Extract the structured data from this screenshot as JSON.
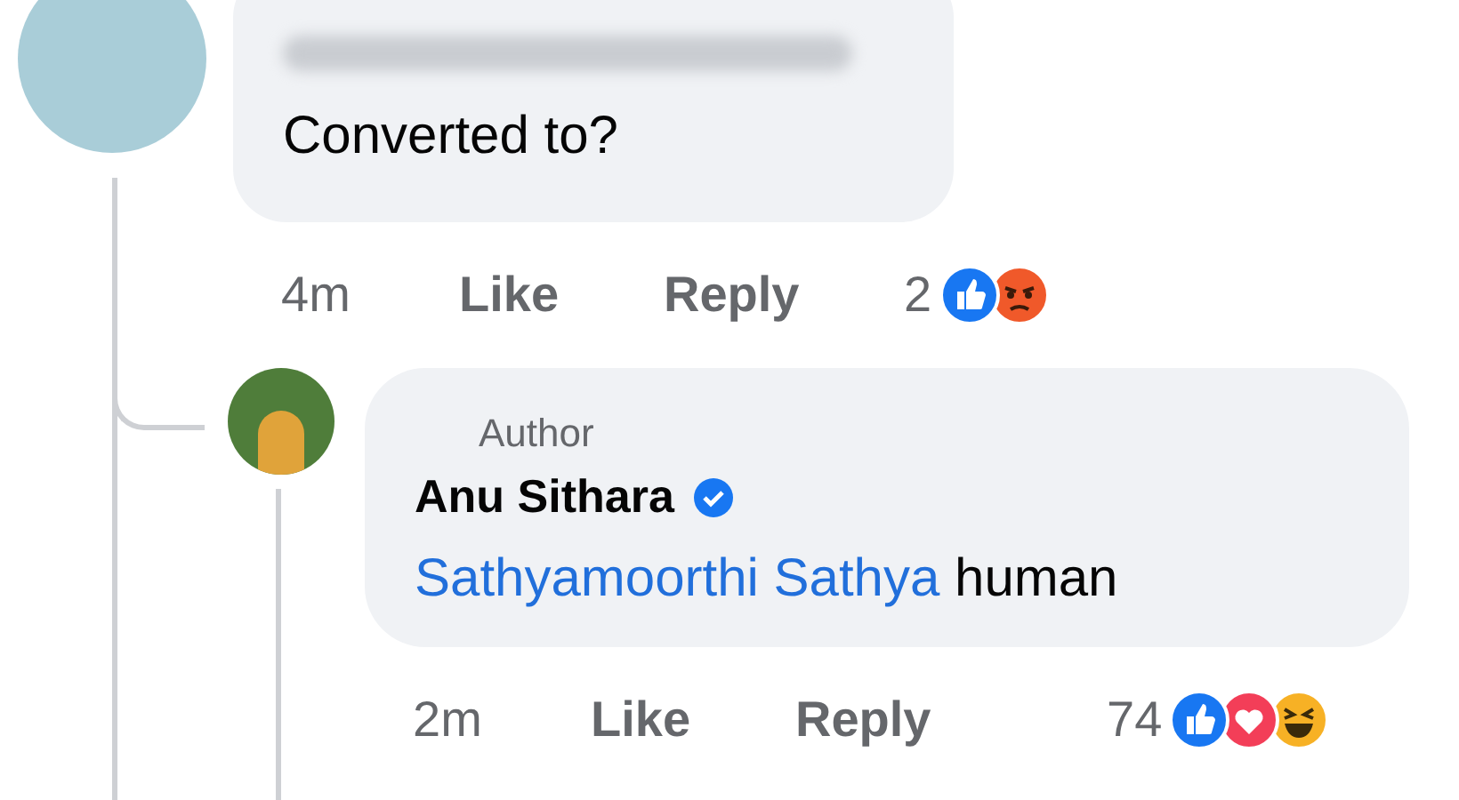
{
  "comment": {
    "text": "Converted to?",
    "time": "4m",
    "actions": [
      "Like",
      "Reply"
    ],
    "reaction_count": "2",
    "reactions": [
      {
        "kind": "like"
      },
      {
        "kind": "angry"
      }
    ]
  },
  "reply": {
    "badge": "Author",
    "author": "Anu Sithara",
    "verified": true,
    "mention": "Sathyamoorthi Sathya",
    "text": "human",
    "time": "2m",
    "actions": [
      "Like",
      "Reply"
    ],
    "reaction_count": "74",
    "reactions": [
      {
        "kind": "like"
      },
      {
        "kind": "love"
      },
      {
        "kind": "haha"
      }
    ]
  }
}
